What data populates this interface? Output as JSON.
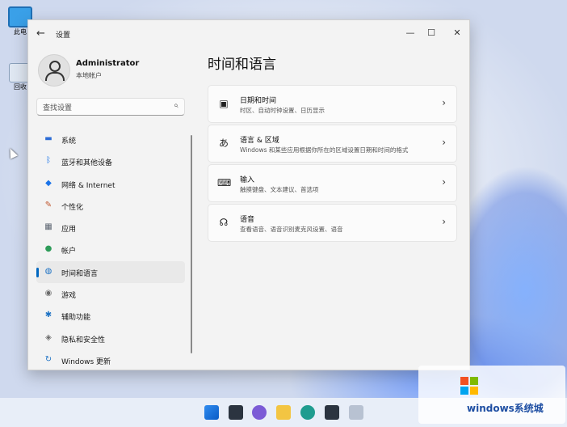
{
  "desktop": {
    "icons": [
      {
        "label": "此电"
      },
      {
        "label": "回收"
      }
    ]
  },
  "window": {
    "title": "设置",
    "controls": {
      "minimize": "—",
      "maximize": "☐",
      "close": "✕"
    }
  },
  "profile": {
    "name": "Administrator",
    "type": "本地帐户"
  },
  "search": {
    "placeholder": "查找设置"
  },
  "nav": {
    "items": [
      {
        "label": "系统",
        "icon": "monitor-icon",
        "color": "#2b6cd6"
      },
      {
        "label": "蓝牙和其他设备",
        "icon": "bluetooth-icon",
        "color": "#1a73e8"
      },
      {
        "label": "网络 & Internet",
        "icon": "wifi-icon",
        "color": "#1a73e8"
      },
      {
        "label": "个性化",
        "icon": "brush-icon",
        "color": "#c0562e"
      },
      {
        "label": "应用",
        "icon": "apps-icon",
        "color": "#5b6470"
      },
      {
        "label": "帐户",
        "icon": "person-icon",
        "color": "#2e9c59"
      },
      {
        "label": "时间和语言",
        "icon": "globe-clock-icon",
        "color": "#1d72c4"
      },
      {
        "label": "游戏",
        "icon": "gamepad-icon",
        "color": "#6b6b6b"
      },
      {
        "label": "辅助功能",
        "icon": "accessibility-icon",
        "color": "#1d72c4"
      },
      {
        "label": "隐私和安全性",
        "icon": "shield-icon",
        "color": "#6b6b6b"
      },
      {
        "label": "Windows 更新",
        "icon": "update-icon",
        "color": "#1d72c4"
      }
    ],
    "active_index": 6
  },
  "main": {
    "title": "时间和语言",
    "cards": [
      {
        "title": "日期和时间",
        "subtitle": "时区、自动时钟设置、日历显示",
        "icon": "calendar-clock-icon"
      },
      {
        "title": "语言 & 区域",
        "subtitle": "Windows 和某些应用根据你所在的区域设置日期和时间的格式",
        "icon": "language-icon"
      },
      {
        "title": "输入",
        "subtitle": "触摸键盘、文本建议、首选项",
        "icon": "keyboard-icon"
      },
      {
        "title": "语音",
        "subtitle": "查看语音、语音识别麦克风设置、语音",
        "icon": "speech-icon"
      }
    ]
  },
  "watermark": {
    "text": "windows系统城"
  },
  "colors": {
    "accent": "#0067c0",
    "window_bg": "#f3f3f3",
    "card_bg": "#fbfbfb"
  }
}
